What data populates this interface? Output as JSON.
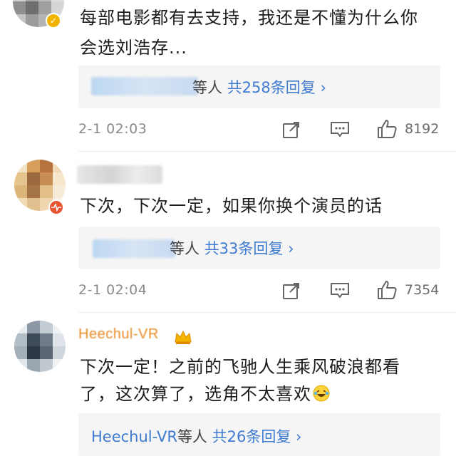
{
  "comments": [
    {
      "text_line1": "每部电影都有去支持，我还是不懂为什么你",
      "text_line2": "会选刘浩存...",
      "reply_suffix": "等人",
      "reply_count": "共258条回复 ›",
      "timestamp": "2-1 02:03",
      "likes": "8192"
    },
    {
      "text_line1": "下次，下次一定，如果你换个演员的话",
      "reply_suffix": "等人",
      "reply_count": "共33条回复 ›",
      "timestamp": "2-1 02:04",
      "likes": "7354"
    },
    {
      "username": "Heechul-VR",
      "text_line1": "下次一定！之前的飞驰人生乘风破浪都看",
      "text_line2": "了，这次算了，选角不太喜欢",
      "reply_name": "Heechul-VR",
      "reply_suffix": "等人",
      "reply_count": "共26条回复 ›"
    }
  ],
  "icons": {
    "share": "share-icon",
    "comment": "comment-icon",
    "like": "thumbs-up-icon",
    "emoji": "laughing-crying-emoji-icon",
    "crown": "crown-badge-icon"
  },
  "colors": {
    "link_blue": "#3e7bd1",
    "username_orange": "#e98d2b",
    "verified_gold": "#f2b400",
    "reply_bg": "#f5f5f5"
  }
}
